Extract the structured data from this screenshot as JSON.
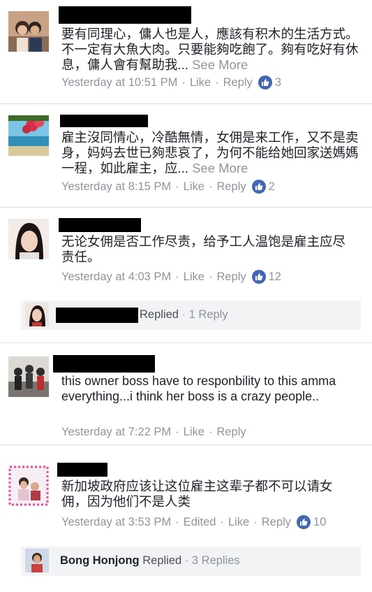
{
  "comments": [
    {
      "text": "要有同理心，傭人也是人，應該有积木的生活方式。不一定有大魚大肉。只要能夠吃飽了。夠有吃好有休息，傭人會有幫助我...",
      "see_more": "See More",
      "time": "Yesterday at 10:51 PM",
      "like": "Like",
      "reply": "Reply",
      "likes": "3"
    },
    {
      "text": "雇主沒同情心，冷酷無情，女佣是来工作，又不是卖身，妈妈去世已夠悲哀了，为何不能给她回家送媽媽一程，如此雇主，应...",
      "see_more": "See More",
      "time": "Yesterday at 8:15 PM",
      "like": "Like",
      "reply": "Reply",
      "likes": "2"
    },
    {
      "text": "无论女佣是否工作尽责，给予工人温饱是雇主应尽责任。",
      "time": "Yesterday at 4:03 PM",
      "like": "Like",
      "reply": "Reply",
      "likes": "12",
      "replies": {
        "replied": "Replied",
        "count": "1 Reply"
      }
    },
    {
      "text": "this owner boss have to responbility to this amma everything...i think her boss is a crazy people..",
      "time": "Yesterday at 7:22 PM",
      "like": "Like",
      "reply": "Reply"
    },
    {
      "text": "新加坡政府应该让这位雇主这辈子都不可以请女佣，因为他们不是人类",
      "time": "Yesterday at 3:53 PM",
      "edited": "Edited",
      "like": "Like",
      "reply": "Reply",
      "likes": "10",
      "replies": {
        "name": "Bong Honjong",
        "replied": "Replied",
        "count": "3 Replies"
      }
    }
  ],
  "colors": {
    "meta": "#90949c",
    "like_badge": "#4267b2",
    "reply_bg": "#f2f3f5"
  },
  "icons": {
    "like": "thumbs-up-icon"
  }
}
